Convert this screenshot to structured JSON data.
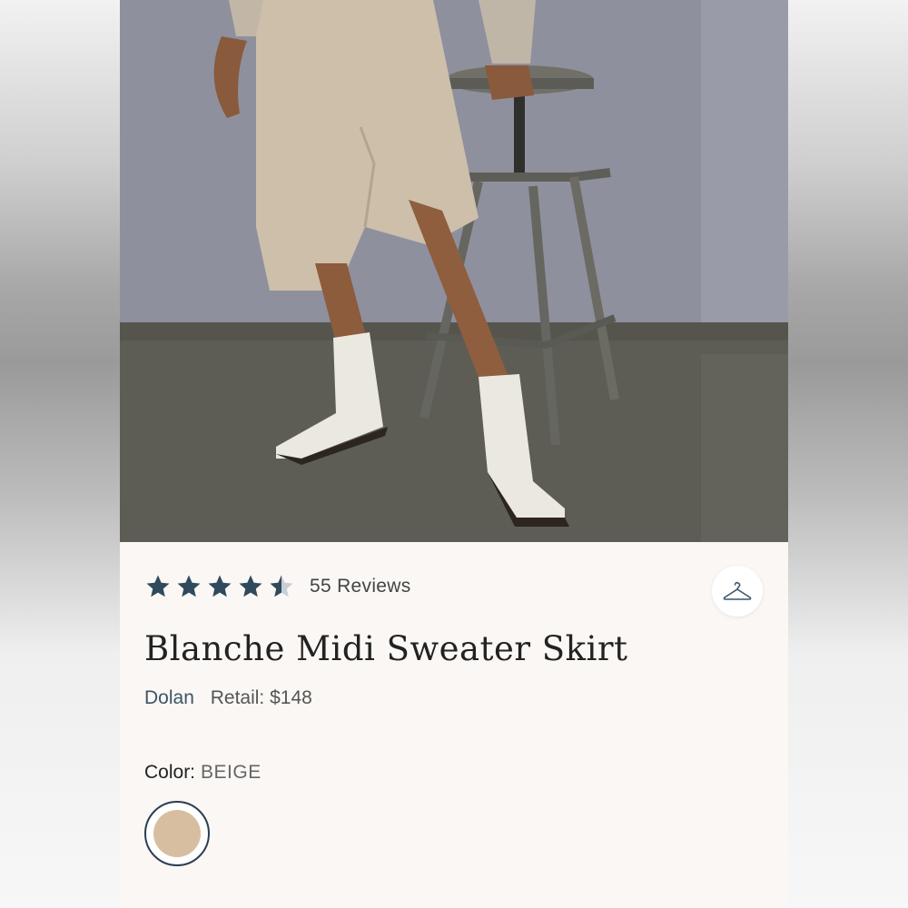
{
  "product": {
    "title": "Blanche Midi Sweater Skirt",
    "brand": "Dolan",
    "retail_label": "Retail:",
    "retail_price": "$148"
  },
  "rating": {
    "value": 4.5,
    "max": 5,
    "reviews_label": "55 Reviews"
  },
  "color": {
    "label": "Color:",
    "value": "BEIGE",
    "swatch_hex": "#d8bea1"
  },
  "icons": {
    "save": "hanger-icon",
    "star": "star-icon"
  },
  "colors": {
    "star": "#2f4a5c",
    "star_empty": "#c7ced6",
    "brand": "#3b5566",
    "card_bg": "#faf7f4"
  }
}
